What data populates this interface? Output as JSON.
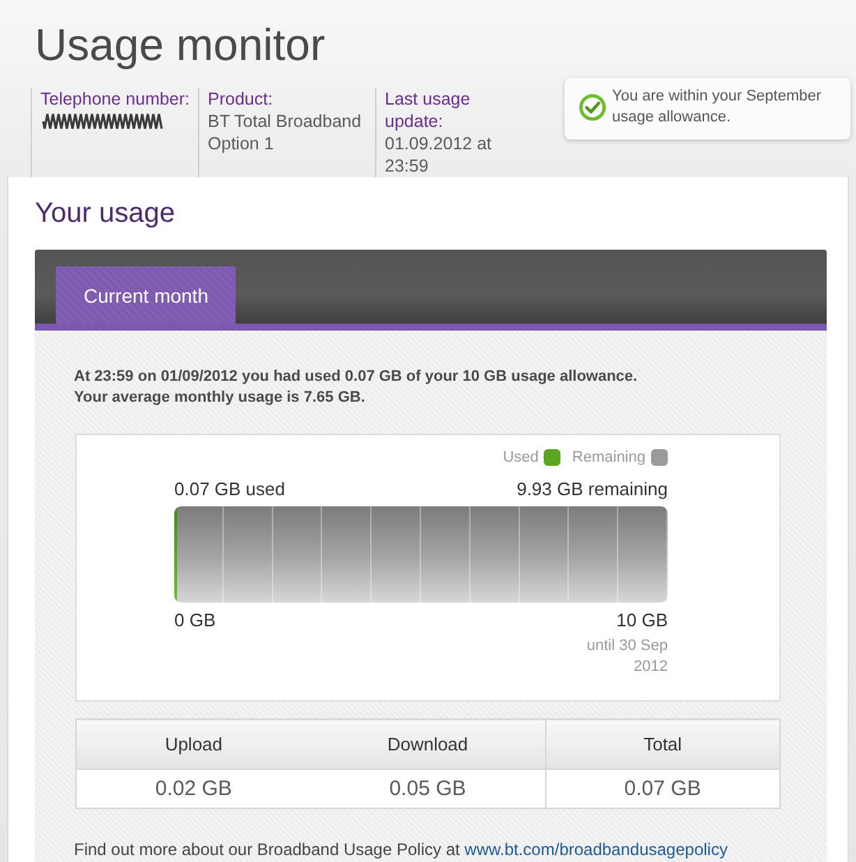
{
  "page": {
    "title": "Usage monitor"
  },
  "account_info": {
    "fields": [
      {
        "kind": "redacted",
        "label": "Telephone number:"
      },
      {
        "kind": "text",
        "label": "Product:",
        "value": "BT Total Broadband Option 1"
      },
      {
        "kind": "text",
        "label": "Last usage update:",
        "value": "01.09.2012 at 23:59"
      }
    ]
  },
  "status_message": {
    "kind": "ok",
    "text": "You are within your September usage allowance."
  },
  "usage": {
    "title": "Your usage",
    "tabs": [
      {
        "label": "Current month",
        "selected": true
      }
    ],
    "summary": [
      "At 23:59 on 01/09/2012 you had used 0.07 GB of your 10 GB usage allowance.",
      "Your average monthly usage is 7.65 GB."
    ],
    "legend": [
      {
        "label": "Used",
        "color": "#5aa71f"
      },
      {
        "label": "Remaining",
        "color": "#9b9b9b"
      }
    ],
    "meter": {
      "used_label": "0.07 GB used",
      "remaining_label": "9.93 GB remaining",
      "level": 0.007,
      "min_label": "0 GB",
      "max_label": "10 GB",
      "period_note": "until 30 Sep 2012"
    },
    "table": {
      "columns": [
        "Upload",
        "Download",
        "Total"
      ],
      "rows": [
        [
          "0.02 GB",
          "0.05 GB",
          "0.07 GB"
        ]
      ]
    },
    "footer": {
      "text": "Find out more about our Broadband Usage Policy at",
      "link": "www.bt.com/broadbandusagepolicy"
    }
  }
}
